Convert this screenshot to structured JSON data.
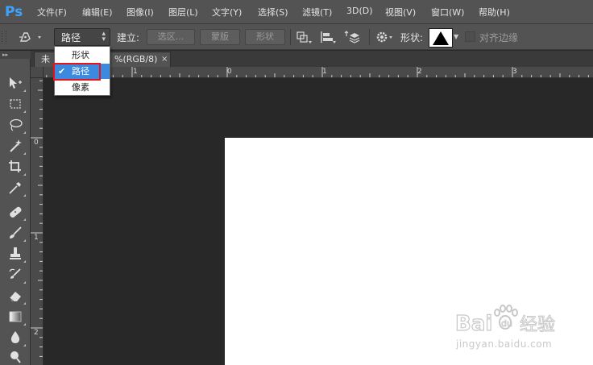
{
  "app": {
    "logo": "Ps"
  },
  "menu": [
    "文件(F)",
    "编辑(E)",
    "图像(I)",
    "图层(L)",
    "文字(Y)",
    "选择(S)",
    "滤镜(T)",
    "3D(D)",
    "视图(V)",
    "窗口(W)",
    "帮助(H)"
  ],
  "options": {
    "tool_preset_icon": "pen-tool-icon",
    "mode_value": "路径",
    "make_label": "建立:",
    "selection_button": "选区...",
    "mask_button": "蒙版",
    "shape_button": "形状",
    "shape_label": "形状:",
    "align_edges_label": "对齐边缘",
    "align_edges_checked": false
  },
  "mode_dropdown": {
    "options": [
      "形状",
      "路径",
      "像素"
    ],
    "selected": "路径",
    "check_glyph": "✔"
  },
  "document_tab": {
    "title_partial": "未",
    "title_suffix": "%(RGB/8)",
    "close_glyph": "×"
  },
  "ruler_top_labels": [
    "1",
    "0",
    "1",
    "2",
    "3"
  ],
  "ruler_left_labels": [
    "0",
    "1",
    "2"
  ],
  "toolbox": {
    "header_glyph": "▸▸"
  },
  "watermark": {
    "url": "jingyan.baidu.com"
  },
  "colors": {
    "accent": "#3c89e0",
    "highlight": "#e8141c",
    "ps_blue": "#3ea3ff",
    "canvas": "#ffffff"
  }
}
